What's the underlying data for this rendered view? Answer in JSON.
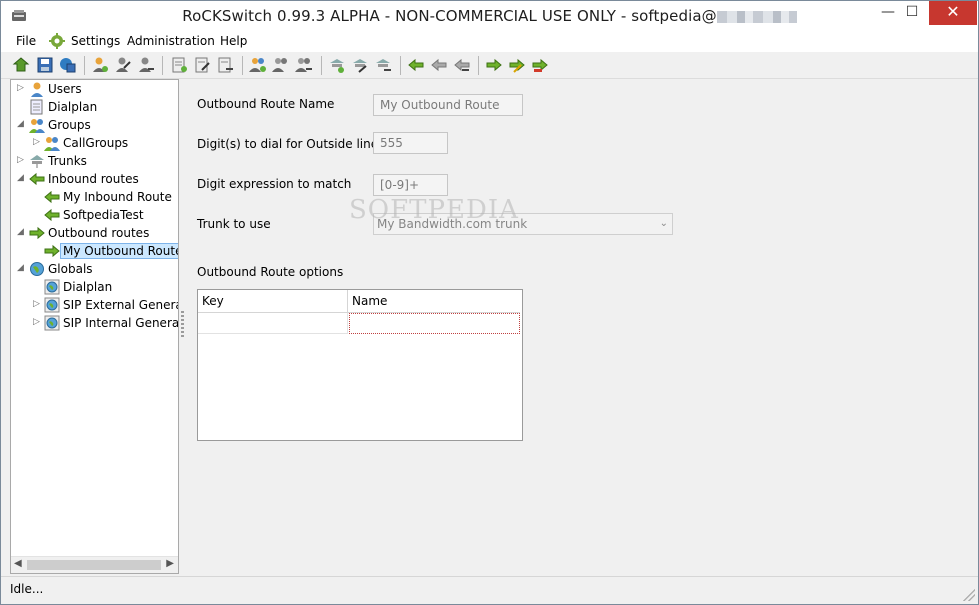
{
  "window": {
    "title": "RoCKSwitch 0.99.3 ALPHA - NON-COMMERCIAL USE ONLY - softpedia@",
    "minimize": "—",
    "maximize": "☐",
    "close": "✕"
  },
  "menu": {
    "file": "File",
    "settings": "Settings",
    "administration": "Administration",
    "help": "Help"
  },
  "tree": [
    {
      "label": "Users"
    },
    {
      "label": "Dialplan"
    },
    {
      "label": "Groups"
    },
    {
      "label": "CallGroups"
    },
    {
      "label": "Trunks"
    },
    {
      "label": "Inbound routes"
    },
    {
      "label": "My Inbound Route"
    },
    {
      "label": "SoftpediaTest"
    },
    {
      "label": "Outbound routes"
    },
    {
      "label": "My Outbound Route"
    },
    {
      "label": "Globals"
    },
    {
      "label": "Dialplan"
    },
    {
      "label": "SIP External General"
    },
    {
      "label": "SIP Internal General"
    }
  ],
  "form": {
    "route_name_label": "Outbound Route Name",
    "route_name_value": "My Outbound Route",
    "digits_label": "Digit(s) to dial for Outside line",
    "digits_value": "555",
    "expression_label": "Digit expression to match",
    "expression_value": "[0-9]+",
    "trunk_label": "Trunk to use",
    "trunk_value": "My Bandwidth.com trunk",
    "options_label": "Outbound Route options",
    "watermark": "SOFTPEDIA"
  },
  "grid": {
    "columns": [
      "Key",
      "Name"
    ]
  },
  "status": {
    "text": "Idle..."
  },
  "colors": {
    "accent_green": "#6fb22c",
    "selection_bg": "#cce8ff",
    "close_red": "#c7372f"
  }
}
